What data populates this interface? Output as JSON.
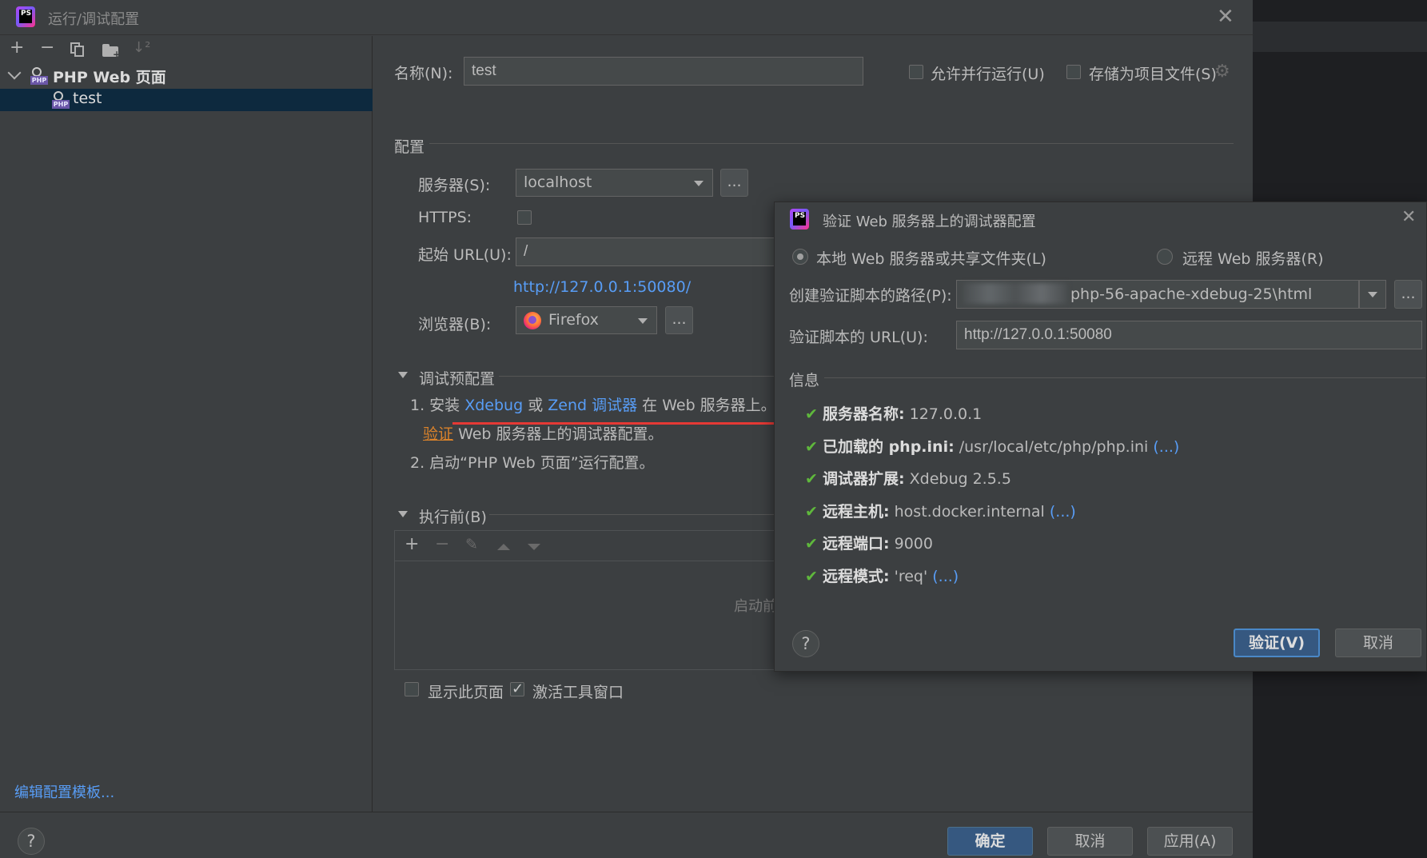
{
  "window": {
    "title": "运行/调试配置",
    "close_icon": "close-icon"
  },
  "sidebar": {
    "tree": {
      "group_label": "PHP Web 页面",
      "item_label": "test"
    },
    "edit_templates_link": "编辑配置模板..."
  },
  "form": {
    "name_label": "名称(N):",
    "name_value": "test",
    "allow_parallel_label": "允许并行运行(U)",
    "store_as_file_label": "存储为项目文件(S)",
    "config_section": "配置",
    "server_label": "服务器(S):",
    "server_value": "localhost",
    "ellipsis": "...",
    "https_label": "HTTPS:",
    "start_url_label": "起始 URL(U):",
    "start_url_value": "/",
    "resolved_url": "http://127.0.0.1:50080/",
    "browser_label": "浏览器(B):",
    "browser_value": "Firefox",
    "debug_section": "调试预配置",
    "step1_prefix": "1. 安装",
    "xdebug_link": "Xdebug",
    "or_text": "或",
    "zend_link": "Zend 调试器",
    "step1_suffix": "在 Web 服务器上。",
    "validate_link": "验证",
    "validate_suffix": "Web 服务器上的调试器配置。",
    "step2": "2. 启动“PHP Web 页面”运行配置。",
    "before_launch_section": "执行前(B)",
    "before_launch_empty": "启动前",
    "show_page_label": "显示此页面",
    "activate_tool_label": "激活工具窗口"
  },
  "footer": {
    "help": "?",
    "ok": "确定",
    "cancel": "取消",
    "apply": "应用(A)"
  },
  "popup": {
    "title": "验证 Web 服务器上的调试器配置",
    "local_radio": "本地 Web 服务器或共享文件夹(L)",
    "remote_radio": "远程 Web 服务器(R)",
    "path_label": "创建验证脚本的路径(P):",
    "path_value": "php-56-apache-xdebug-25\\html",
    "ellipsis": "...",
    "url_label": "验证脚本的 URL(U):",
    "url_value": "http://127.0.0.1:50080",
    "info_section": "信息",
    "info": [
      {
        "key": "服务器名称:",
        "value": "127.0.0.1",
        "more": ""
      },
      {
        "key": "已加载的 php.ini:",
        "value": "/usr/local/etc/php/php.ini",
        "more": "(...)"
      },
      {
        "key": "调试器扩展:",
        "value": "Xdebug 2.5.5",
        "more": ""
      },
      {
        "key": "远程主机:",
        "value": "host.docker.internal",
        "more": "(...)"
      },
      {
        "key": "远程端口:",
        "value": "9000",
        "more": ""
      },
      {
        "key": "远程模式:",
        "value": "'req'",
        "more": "(...)"
      }
    ],
    "help": "?",
    "validate_button": "验证(V)",
    "cancel_button": "取消"
  },
  "colors": {
    "link": "#589df6",
    "check": "#5fb83c",
    "accent_button": "#365880",
    "arrow": "#e53935"
  }
}
